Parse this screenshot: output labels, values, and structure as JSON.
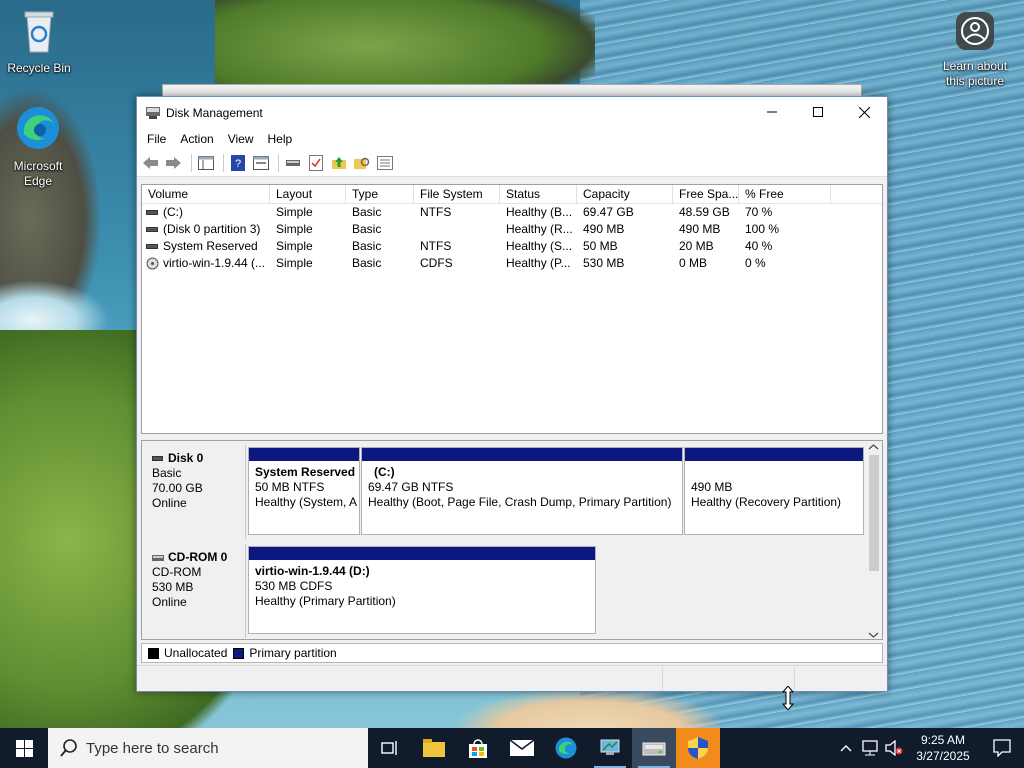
{
  "desktop": {
    "icons": [
      {
        "label": "Recycle Bin"
      },
      {
        "label": "Microsoft Edge"
      },
      {
        "label": "Learn about this picture"
      }
    ]
  },
  "window": {
    "title": "Disk Management",
    "menu": [
      "File",
      "Action",
      "View",
      "Help"
    ],
    "columns": [
      "Volume",
      "Layout",
      "Type",
      "File System",
      "Status",
      "Capacity",
      "Free Spa...",
      "% Free"
    ],
    "volumes": [
      {
        "volume": "(C:)",
        "layout": "Simple",
        "type": "Basic",
        "fs": "NTFS",
        "status": "Healthy (B...",
        "capacity": "69.47 GB",
        "free": "48.59 GB",
        "pct": "70 %"
      },
      {
        "volume": "(Disk 0 partition 3)",
        "layout": "Simple",
        "type": "Basic",
        "fs": "",
        "status": "Healthy (R...",
        "capacity": "490 MB",
        "free": "490 MB",
        "pct": "100 %"
      },
      {
        "volume": "System Reserved",
        "layout": "Simple",
        "type": "Basic",
        "fs": "NTFS",
        "status": "Healthy (S...",
        "capacity": "50 MB",
        "free": "20 MB",
        "pct": "40 %"
      },
      {
        "volume": "virtio-win-1.9.44 (...",
        "layout": "Simple",
        "type": "Basic",
        "fs": "CDFS",
        "status": "Healthy (P...",
        "capacity": "530 MB",
        "free": "0 MB",
        "pct": "0 %"
      }
    ],
    "disks": [
      {
        "name": "Disk 0",
        "kind": "Basic",
        "size": "70.00 GB",
        "state": "Online",
        "partitions": [
          {
            "name": "System Reserved",
            "detail": "50 MB NTFS",
            "status": "Healthy (System, A"
          },
          {
            "name": "(C:)",
            "detail": "69.47 GB NTFS",
            "status": "Healthy (Boot, Page File, Crash Dump, Primary Partition)"
          },
          {
            "name": "",
            "detail": "490 MB",
            "status": "Healthy (Recovery Partition)"
          }
        ]
      },
      {
        "name": "CD-ROM 0",
        "kind": "CD-ROM",
        "size": "530 MB",
        "state": "Online",
        "partitions": [
          {
            "name": "virtio-win-1.9.44  (D:)",
            "detail": "530 MB CDFS",
            "status": "Healthy (Primary Partition)"
          }
        ]
      }
    ],
    "legend": [
      {
        "label": "Unallocated",
        "color": "#000000"
      },
      {
        "label": "Primary partition",
        "color": "#0a1880"
      }
    ]
  },
  "taskbar": {
    "search_placeholder": "Type here to search",
    "time": "9:25 AM",
    "date": "3/27/2025"
  },
  "colors": {
    "partition_bar": "#0a1880",
    "taskbar": "#101c2c"
  }
}
